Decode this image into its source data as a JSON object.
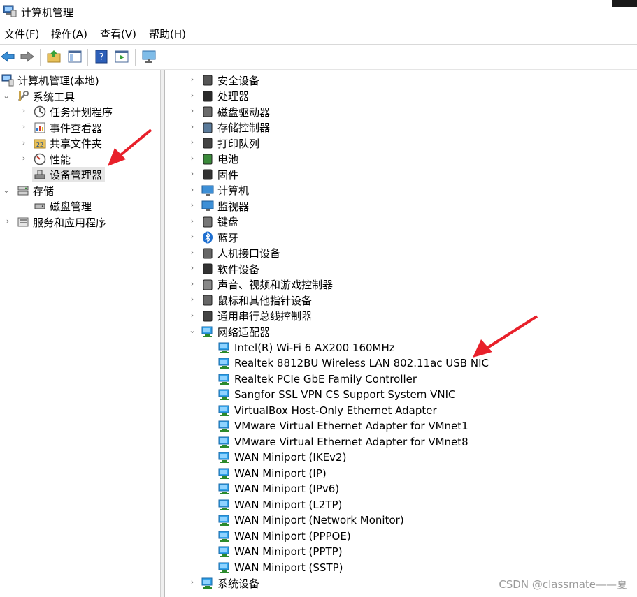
{
  "window": {
    "title": "计算机管理"
  },
  "menu": [
    "文件(F)",
    "操作(A)",
    "查看(V)",
    "帮助(H)"
  ],
  "toolbar": {
    "icons": [
      "back-arrow-icon",
      "forward-arrow-icon",
      "up-folder-icon",
      "show-hide-tree-icon",
      "help-icon",
      "properties-icon",
      "monitor-icon"
    ]
  },
  "left_tree": {
    "root": "计算机管理(本地)",
    "system_tools": "系统工具",
    "task_scheduler": "任务计划程序",
    "event_viewer": "事件查看器",
    "shared_folders": "共享文件夹",
    "performance": "性能",
    "device_manager": "设备管理器",
    "storage": "存储",
    "disk_management": "磁盘管理",
    "services_apps": "服务和应用程序"
  },
  "right_tree": {
    "categories_top": [
      "安全设备",
      "处理器",
      "磁盘驱动器",
      "存储控制器",
      "打印队列",
      "电池",
      "固件",
      "计算机",
      "监视器",
      "键盘",
      "蓝牙",
      "人机接口设备",
      "软件设备",
      "声音、视频和游戏控制器",
      "鼠标和其他指针设备",
      "通用串行总线控制器"
    ],
    "network_adapters": "网络适配器",
    "adapters": [
      "Intel(R) Wi-Fi 6 AX200 160MHz",
      "Realtek 8812BU Wireless LAN 802.11ac USB NIC",
      "Realtek PCIe GbE Family Controller",
      "Sangfor SSL VPN CS Support System VNIC",
      "VirtualBox Host-Only Ethernet Adapter",
      "VMware Virtual Ethernet Adapter for VMnet1",
      "VMware Virtual Ethernet Adapter for VMnet8",
      "WAN Miniport (IKEv2)",
      "WAN Miniport (IP)",
      "WAN Miniport (IPv6)",
      "WAN Miniport (L2TP)",
      "WAN Miniport (Network Monitor)",
      "WAN Miniport (PPPOE)",
      "WAN Miniport (PPTP)",
      "WAN Miniport (SSTP)"
    ],
    "system_devices": "系统设备"
  },
  "watermark": "CSDN @classmate——夏",
  "colors": {
    "arrow": "#e8202a",
    "selected": "#e5e5e5",
    "netblue": "#1e8fd8"
  }
}
